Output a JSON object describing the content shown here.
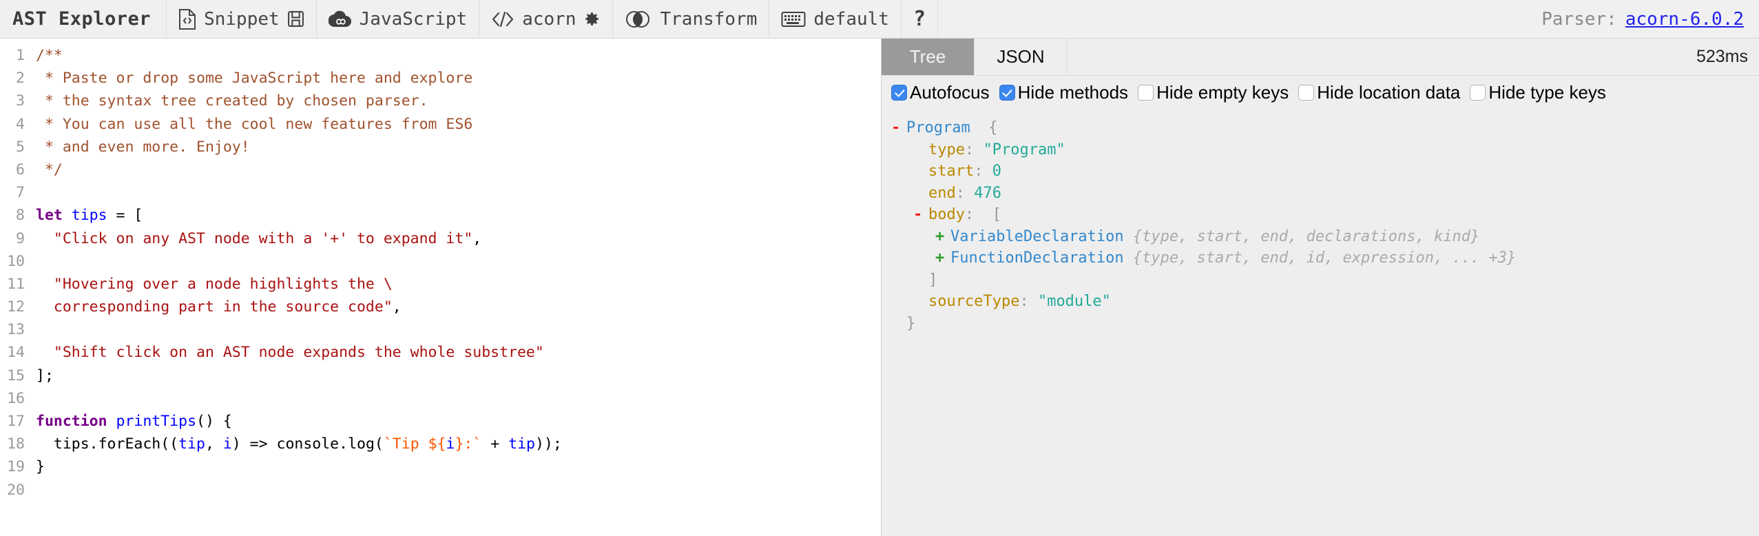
{
  "toolbar": {
    "brand": "AST Explorer",
    "items": [
      {
        "icon": "code-file-icon",
        "label": "Snippet",
        "trailing_icon": "save-disk-icon"
      },
      {
        "icon": "acorn-cloud-icon",
        "label": "JavaScript",
        "trailing_icon": ""
      },
      {
        "icon": "angle-brackets-icon",
        "label": "acorn",
        "trailing_icon": "gear-icon"
      },
      {
        "icon": "venn-circles-icon",
        "label": "Transform",
        "trailing_icon": ""
      },
      {
        "icon": "keyboard-icon",
        "label": "default",
        "trailing_icon": ""
      },
      {
        "icon": "question-mark-icon",
        "label": "?",
        "trailing_icon": ""
      }
    ],
    "parser_label": "Parser:",
    "parser_version": "acorn-6.0.2",
    "link_color": "#2222ee"
  },
  "editor": {
    "first_line": 1,
    "last_line": 20,
    "lines": [
      {
        "n": 1,
        "tokens": [
          {
            "t": "comment",
            "s": "/**"
          }
        ]
      },
      {
        "n": 2,
        "tokens": [
          {
            "t": "comment",
            "s": " * Paste or drop some JavaScript here and explore"
          }
        ]
      },
      {
        "n": 3,
        "tokens": [
          {
            "t": "comment",
            "s": " * the syntax tree created by chosen parser."
          }
        ]
      },
      {
        "n": 4,
        "tokens": [
          {
            "t": "comment",
            "s": " * You can use all the cool new features from ES6"
          }
        ]
      },
      {
        "n": 5,
        "tokens": [
          {
            "t": "comment",
            "s": " * and even more. Enjoy!"
          }
        ]
      },
      {
        "n": 6,
        "tokens": [
          {
            "t": "comment",
            "s": " */"
          }
        ]
      },
      {
        "n": 7,
        "tokens": []
      },
      {
        "n": 8,
        "tokens": [
          {
            "t": "keyword",
            "s": "let"
          },
          {
            "t": "plain",
            "s": " "
          },
          {
            "t": "def",
            "s": "tips"
          },
          {
            "t": "plain",
            "s": " = ["
          }
        ]
      },
      {
        "n": 9,
        "tokens": [
          {
            "t": "plain",
            "s": "  "
          },
          {
            "t": "string",
            "s": "\"Click on any AST node with a '+' to expand it\""
          },
          {
            "t": "plain",
            "s": ","
          }
        ]
      },
      {
        "n": 10,
        "tokens": []
      },
      {
        "n": 11,
        "tokens": [
          {
            "t": "plain",
            "s": "  "
          },
          {
            "t": "string",
            "s": "\"Hovering over a node highlights the \\"
          }
        ]
      },
      {
        "n": 12,
        "tokens": [
          {
            "t": "string",
            "s": "  corresponding part in the source code\""
          },
          {
            "t": "plain",
            "s": ","
          }
        ]
      },
      {
        "n": 13,
        "tokens": []
      },
      {
        "n": 14,
        "tokens": [
          {
            "t": "plain",
            "s": "  "
          },
          {
            "t": "string",
            "s": "\"Shift click on an AST node expands the whole substree\""
          }
        ]
      },
      {
        "n": 15,
        "tokens": [
          {
            "t": "plain",
            "s": "];"
          }
        ]
      },
      {
        "n": 16,
        "tokens": []
      },
      {
        "n": 17,
        "tokens": [
          {
            "t": "keyword",
            "s": "function"
          },
          {
            "t": "plain",
            "s": " "
          },
          {
            "t": "def",
            "s": "printTips"
          },
          {
            "t": "plain",
            "s": "() {"
          }
        ]
      },
      {
        "n": 18,
        "tokens": [
          {
            "t": "plain",
            "s": "  tips.forEach(("
          },
          {
            "t": "var",
            "s": "tip"
          },
          {
            "t": "plain",
            "s": ", "
          },
          {
            "t": "var",
            "s": "i"
          },
          {
            "t": "plain",
            "s": ") => console.log("
          },
          {
            "t": "string-2",
            "s": "`Tip $"
          },
          {
            "t": "string-2",
            "s": "{"
          },
          {
            "t": "var",
            "s": "i"
          },
          {
            "t": "string-2",
            "s": "}:`"
          },
          {
            "t": "plain",
            "s": " + "
          },
          {
            "t": "var",
            "s": "tip"
          },
          {
            "t": "plain",
            "s": "));"
          }
        ]
      },
      {
        "n": 19,
        "tokens": [
          {
            "t": "plain",
            "s": "}"
          }
        ]
      },
      {
        "n": 20,
        "tokens": []
      }
    ]
  },
  "ast_panel": {
    "tabs": [
      {
        "label": "Tree",
        "active": true
      },
      {
        "label": "JSON",
        "active": false
      }
    ],
    "timing": "523ms",
    "options": [
      {
        "label": "Autofocus",
        "checked": true
      },
      {
        "label": "Hide methods",
        "checked": true
      },
      {
        "label": "Hide empty keys",
        "checked": false
      },
      {
        "label": "Hide location data",
        "checked": false
      },
      {
        "label": "Hide type keys",
        "checked": false
      }
    ],
    "tree": [
      {
        "indent": 0,
        "toggle": "-",
        "node": "Program",
        "bracket": "{"
      },
      {
        "indent": 1,
        "toggle": "",
        "key": "type",
        "value": "\"Program\"",
        "value_type": "string"
      },
      {
        "indent": 1,
        "toggle": "",
        "key": "start",
        "value": "0",
        "value_type": "number"
      },
      {
        "indent": 1,
        "toggle": "",
        "key": "end",
        "value": "476",
        "value_type": "number"
      },
      {
        "indent": 1,
        "toggle": "-",
        "key": "body",
        "bracket": "["
      },
      {
        "indent": 2,
        "toggle": "+",
        "node": "VariableDeclaration",
        "preview": "{type, start, end, declarations, kind}"
      },
      {
        "indent": 2,
        "toggle": "+",
        "node": "FunctionDeclaration",
        "preview": "{type, start, end, id, expression, ... +3}"
      },
      {
        "indent": 1,
        "toggle": "",
        "bracket_close": "]"
      },
      {
        "indent": 1,
        "toggle": "",
        "key": "sourceType",
        "value": "\"module\"",
        "value_type": "string"
      },
      {
        "indent": 0,
        "toggle": "",
        "bracket_close": "}"
      }
    ]
  },
  "colors": {
    "toolbar_bg": "#f0f0f0",
    "panel_bg": "#eeeeee",
    "active_tab_bg": "#9a9a9a",
    "checkbox_on": "#3b87f0",
    "node_name": "#3388cc",
    "prop_key": "#bb8800",
    "value": "#22aa99",
    "comment": "#a0522d",
    "string": "#aa1111",
    "keyword": "#770088",
    "variable": "#0000ff",
    "template": "#ff5500"
  }
}
